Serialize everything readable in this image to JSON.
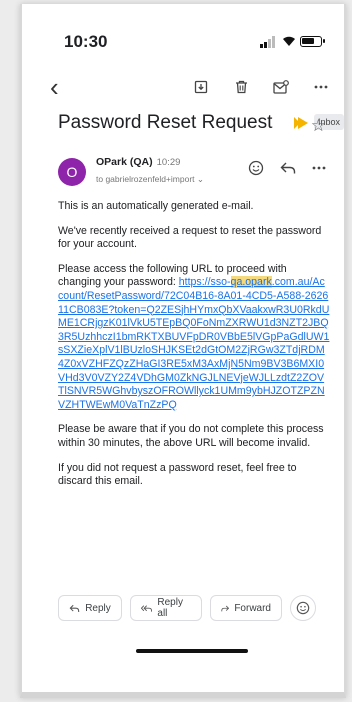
{
  "status": {
    "time": "10:30"
  },
  "toolbar": {
    "back": "‹"
  },
  "subject": {
    "title": "Password Reset Request",
    "label": "Inbox"
  },
  "sender": {
    "initial": "O",
    "name": "OPark (QA)",
    "time": "10:29",
    "to": "to gabrielrozenfeld+import ⌄"
  },
  "body": {
    "p1": "This is an automatically generated e-mail.",
    "p2": "We've recently received a request to reset the password for your account.",
    "p3_prefix": "Please access the following URL to proceed with changing your password: ",
    "link_pre": "https://sso-",
    "link_hl": "qa.opark",
    "link_rest": ".com.au/Account/ResetPassword/72C04B16-8A01-4CD5-A588-262611CB083E?token=Q2ZESjhHYmxQbXVaakxwR3U0RkdUME1CRjgzK01lVkU5TEpBQ0FoNmZXRWU1d3NZT2JBQ3R5UzhhczI1bmRKTXBUVFpDR0VBbE5lVGpPaGdlUW1sSXZieXplV1lBUzloSHJKSEt2dGtOM2ZjRGw3ZTdjRDM4Z0xVZHFZQzZHaGI3RE5xM3AxMjN5Nm9BV3B6MXI0VHd3V0VZY2Z4VDhGM0ZkNGJLNEVjeWJLLzdtZ2ZOVTlSNVR5WGhvbyszOFROWllyck1UMm9ybHJZOTZPZNVZHTWEwM0VaTnZzPQ",
    "p4": "Please be aware that if you do not complete this process within 30 minutes, the above URL will become invalid.",
    "p5": "If you did not request a password reset, feel free to discard this email."
  },
  "actions": {
    "reply": "Reply",
    "reply_all": "Reply all",
    "forward": "Forward"
  },
  "colors": {
    "avatar": "#8e24aa",
    "link": "#1a73e8",
    "highlight": "#f5d97e",
    "important": "#f4b400"
  }
}
